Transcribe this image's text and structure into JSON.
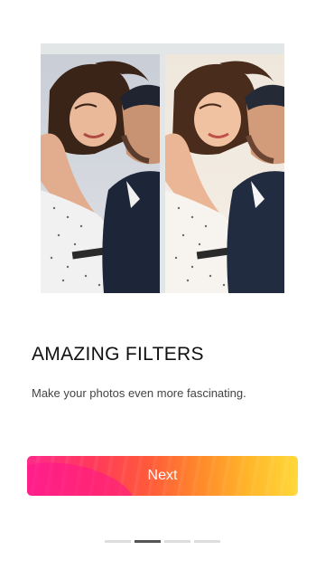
{
  "onboarding": {
    "title": "AMAZING FILTERS",
    "subtitle": "Make your photos even more fascinating.",
    "next_label": "Next"
  },
  "preview": {
    "left_image": "couple-photo-original",
    "right_image": "couple-photo-filtered",
    "background": "#e3e6e6"
  },
  "pager": {
    "total_pages": 4,
    "active_page": 2
  },
  "colors": {
    "button_gradient_start": "#ff2b8a",
    "button_gradient_end": "#ffd83a",
    "pager_active": "#555555",
    "pager_inactive": "#dddddd"
  }
}
